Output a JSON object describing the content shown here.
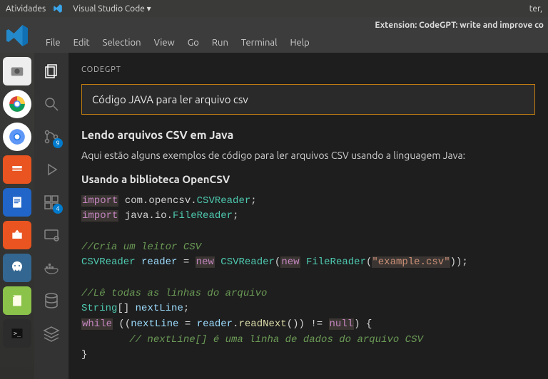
{
  "os_topbar": {
    "activities": "Atividades",
    "app_name": "Visual Studio Code ▾",
    "clock": "ter,"
  },
  "titlebar": {
    "title": "Extension: CodeGPT: write and improve co"
  },
  "menu": {
    "file": "File",
    "edit": "Edit",
    "selection": "Selection",
    "view": "View",
    "go": "Go",
    "run": "Run",
    "terminal": "Terminal",
    "help": "Help"
  },
  "activitybar": {
    "badges": {
      "scm": "9",
      "extensions": "4"
    }
  },
  "panel": {
    "header": "CODEGPT",
    "input_value": "Código JAVA para ler arquivo csv",
    "h1": "Lendo arquivos CSV em Java",
    "p1": "Aqui estão alguns exemplos de código para ler arquivos CSV usando a linguagem Java:",
    "h2": "Usando a biblioteca OpenCSV",
    "code": {
      "l1_kw": "import",
      "l1_rest": " com.opencsv.",
      "l1_cls": "CSVReader",
      "l1_sc": ";",
      "l2_kw": "import",
      "l2_rest": " java.io.",
      "l2_cls": "FileReader",
      "l2_sc": ";",
      "l4_com": "//Cria um leitor CSV",
      "l5_cls1": "CSVReader",
      "l5_sp1": " ",
      "l5_var": "reader",
      "l5_eq": " = ",
      "l5_kw1": "new",
      "l5_sp2": " ",
      "l5_cls2": "CSVReader",
      "l5_p1": "(",
      "l5_kw2": "new",
      "l5_sp3": " ",
      "l5_cls3": "FileReader",
      "l5_p2": "(",
      "l5_str": "\"example.csv\"",
      "l5_p3": "));",
      "l7_com": "//Lê todas as linhas do arquivo",
      "l8_cls": "String",
      "l8_arr": "[] ",
      "l8_var": "nextLine",
      "l8_sc": ";",
      "l9_kw": "while",
      "l9_p1": " ((",
      "l9_var1": "nextLine",
      "l9_eq": " = ",
      "l9_var2": "reader",
      "l9_dot": ".",
      "l9_fn": "readNext",
      "l9_p2": "()) != ",
      "l9_kw2": "null",
      "l9_p3": ") {",
      "l10_com": "        // nextLine[] é uma linha de dados do arquivo CSV",
      "l11": "}"
    }
  },
  "dock": {
    "apps": [
      "camera",
      "chrome",
      "chromium",
      "files",
      "writer",
      "software",
      "postgres",
      "notes",
      "terminal"
    ]
  }
}
